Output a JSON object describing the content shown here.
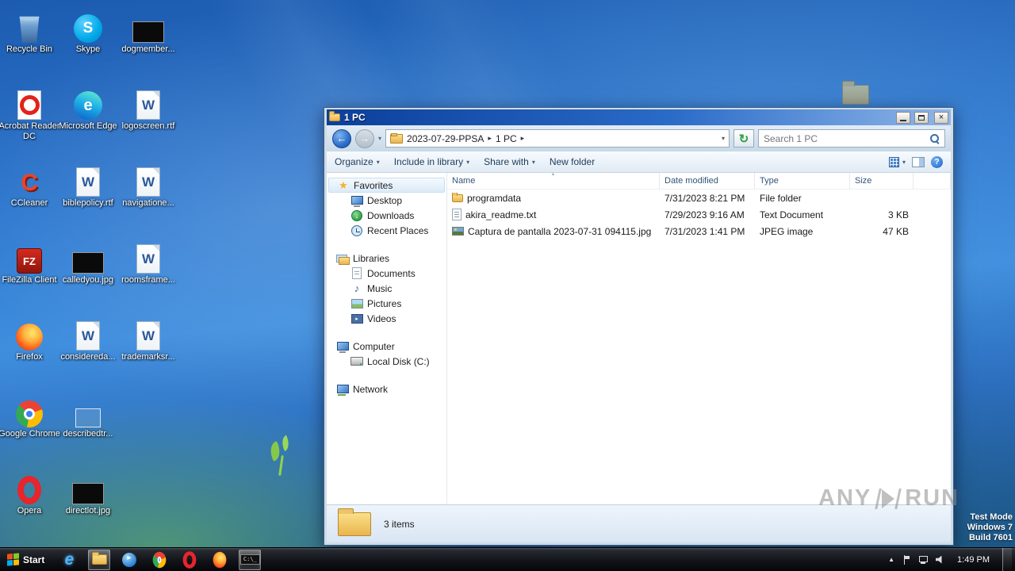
{
  "icons": {
    "dropdown": "▾",
    "crumb_sep": "▸",
    "back": "←",
    "forward": "→",
    "refresh": "↻",
    "close": "×",
    "sort": "▲",
    "tray_up": "▲",
    "help": "?"
  },
  "desktop": {
    "icons": [
      {
        "label": "Recycle Bin"
      },
      {
        "label": "Acrobat Reader DC"
      },
      {
        "label": "CCleaner"
      },
      {
        "label": "FileZilla Client"
      },
      {
        "label": "Firefox"
      },
      {
        "label": "Google Chrome"
      },
      {
        "label": "Opera"
      },
      {
        "label": "Skype"
      },
      {
        "label": "Microsoft Edge"
      },
      {
        "label": "biblepolicy.rtf"
      },
      {
        "label": "calledyou.jpg"
      },
      {
        "label": "considereda..."
      },
      {
        "label": "describedtr..."
      },
      {
        "label": "directlot.jpg"
      },
      {
        "label": "dogmember..."
      },
      {
        "label": "logoscreen.rtf"
      },
      {
        "label": "navigatione..."
      },
      {
        "label": "roomsframe..."
      },
      {
        "label": "trademarksr..."
      }
    ]
  },
  "window": {
    "title": "1 PC",
    "address": {
      "crumb1": "2023-07-29-PPSA",
      "crumb2": "1 PC",
      "search_placeholder": "Search 1 PC"
    },
    "toolbar": {
      "organize": "Organize",
      "include": "Include in library",
      "share": "Share with",
      "new_folder": "New folder"
    },
    "sidebar": {
      "favorites": "Favorites",
      "desktop": "Desktop",
      "downloads": "Downloads",
      "recent": "Recent Places",
      "libraries": "Libraries",
      "documents": "Documents",
      "music": "Music",
      "pictures": "Pictures",
      "videos": "Videos",
      "computer": "Computer",
      "local_disk": "Local Disk (C:)",
      "network": "Network"
    },
    "columns": {
      "name": "Name",
      "date": "Date modified",
      "type": "Type",
      "size": "Size"
    },
    "files": [
      {
        "name": "programdata",
        "date": "7/31/2023 8:21 PM",
        "type": "File folder",
        "size": ""
      },
      {
        "name": "akira_readme.txt",
        "date": "7/29/2023 9:16 AM",
        "type": "Text Document",
        "size": "3 KB"
      },
      {
        "name": "Captura de pantalla 2023-07-31 094115.jpg",
        "date": "7/31/2023 1:41 PM",
        "type": "JPEG image",
        "size": "47 KB"
      }
    ],
    "status": "3 items"
  },
  "taskbar": {
    "start_label": "Start",
    "time": "1:49 PM"
  },
  "watermark": {
    "any": "ANY",
    "run": "RUN"
  },
  "testmode": {
    "line1": "Test Mode",
    "line2": "Windows 7",
    "line3": "Build 7601"
  }
}
